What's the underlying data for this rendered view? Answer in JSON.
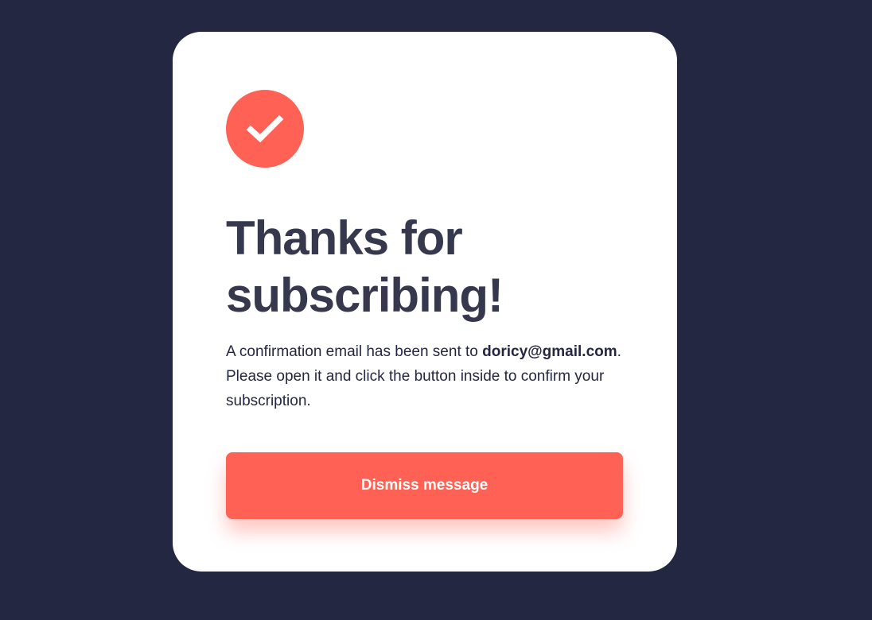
{
  "card": {
    "icon": "check-icon",
    "title": "Thanks for subscribing!",
    "message": {
      "before_email": "A confirmation email has been sent to ",
      "email": "doricy@gmail.com",
      "after_email": ". Please open it and click the button inside to confirm your subscription."
    },
    "dismiss_label": "Dismiss message"
  },
  "colors": {
    "background": "#242742",
    "card": "#FFFFFF",
    "accent": "#FF6155",
    "heading": "#36384E",
    "body_text": "#242742"
  }
}
